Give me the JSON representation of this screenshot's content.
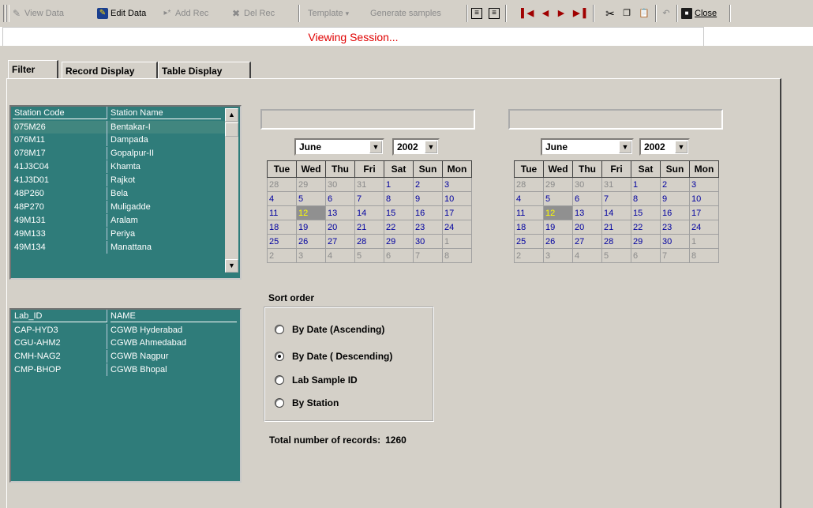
{
  "toolbar": {
    "view_data": "View Data",
    "edit_data": "Edit Data",
    "add_rec": "Add Rec",
    "del_rec": "Del Rec",
    "template": "Template",
    "generate_samples": "Generate samples",
    "close": "Close"
  },
  "status": "Viewing Session...",
  "tabs": [
    "Filter",
    "Record Display",
    "Table Display"
  ],
  "stations": {
    "headers": [
      "Station Code",
      "Station Name"
    ],
    "rows": [
      [
        "075M26",
        "Bentakar-I"
      ],
      [
        "076M11",
        "Dampada"
      ],
      [
        "078M17",
        "Gopalpur-II"
      ],
      [
        "41J3C04",
        "Khamta"
      ],
      [
        "41J3D01",
        "Rajkot"
      ],
      [
        "48P260",
        "Bela"
      ],
      [
        "48P270",
        "Muligadde"
      ],
      [
        "49M131",
        "Aralam"
      ],
      [
        "49M133",
        "Periya"
      ],
      [
        "49M134",
        "Manattana"
      ]
    ]
  },
  "labs": {
    "headers": [
      "Lab_ID",
      "NAME"
    ],
    "rows": [
      [
        "CAP-HYD3",
        "CGWB Hyderabad"
      ],
      [
        "CGU-AHM2",
        "CGWB Ahmedabad"
      ],
      [
        "CMH-NAG2",
        "CGWB Nagpur"
      ],
      [
        "CMP-BHOP",
        "CGWB Bhopal"
      ]
    ]
  },
  "calendar": {
    "month": "June",
    "year": "2002",
    "weekdays": [
      "Tue",
      "Wed",
      "Thu",
      "Fri",
      "Sat",
      "Sun",
      "Mon"
    ],
    "weeks": [
      [
        "28",
        "29",
        "30",
        "31",
        "1",
        "2",
        "3"
      ],
      [
        "4",
        "5",
        "6",
        "7",
        "8",
        "9",
        "10"
      ],
      [
        "11",
        "12",
        "13",
        "14",
        "15",
        "16",
        "17"
      ],
      [
        "18",
        "19",
        "20",
        "21",
        "22",
        "23",
        "24"
      ],
      [
        "25",
        "26",
        "27",
        "28",
        "29",
        "30",
        "1"
      ],
      [
        "2",
        "3",
        "4",
        "5",
        "6",
        "7",
        "8"
      ]
    ],
    "today": "12"
  },
  "sort": {
    "title": "Sort order",
    "options": [
      "By Date (Ascending)",
      "By Date ( Descending)",
      "Lab Sample ID",
      "By Station"
    ],
    "selected_index": 1
  },
  "total": {
    "label": "Total number of records:",
    "value": "1260"
  },
  "colors": {
    "list_bg": "#2f7c7a",
    "status_text": "#e00000",
    "window_bg": "#d4d0c8"
  }
}
